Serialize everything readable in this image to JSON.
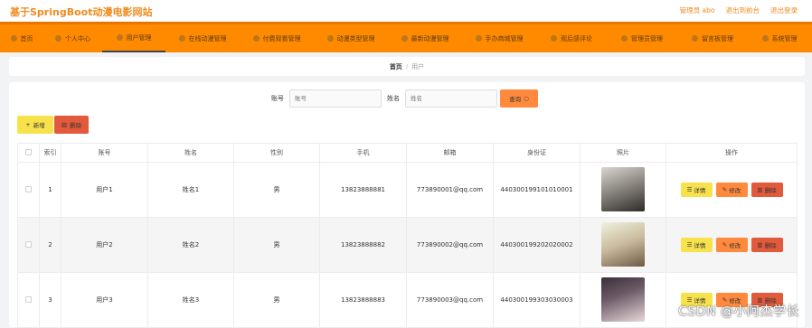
{
  "header": {
    "title": "基于SpringBoot动漫电影网站",
    "links": [
      "管理员 abo",
      "退出到前台",
      "退出登录"
    ]
  },
  "nav": {
    "items": [
      {
        "label": "首页",
        "icon": "home-icon"
      },
      {
        "label": "个人中心",
        "icon": "user-icon"
      },
      {
        "label": "用户管理",
        "icon": "users-icon",
        "active": true
      },
      {
        "label": "在线动漫管理",
        "icon": "film-icon"
      },
      {
        "label": "付费观看管理",
        "icon": "coin-icon"
      },
      {
        "label": "动漫类型管理",
        "icon": "tag-icon"
      },
      {
        "label": "最新动漫管理",
        "icon": "star-icon"
      },
      {
        "label": "手办商城管理",
        "icon": "shop-icon"
      },
      {
        "label": "观后感评论",
        "icon": "comment-icon"
      },
      {
        "label": "管理员管理",
        "icon": "admin-icon"
      },
      {
        "label": "留言板管理",
        "icon": "message-icon"
      },
      {
        "label": "系统管理",
        "icon": "gear-icon"
      }
    ]
  },
  "breadcrumb": {
    "home": "首页",
    "separator": "/",
    "current": "用户"
  },
  "search": {
    "account_label": "账号",
    "account_placeholder": "账号",
    "name_label": "姓名",
    "name_placeholder": "姓名",
    "query_label": "查询"
  },
  "actions": {
    "add_label": "新增",
    "delete_label": "删除"
  },
  "table": {
    "headers": [
      "索引",
      "账号",
      "姓名",
      "性别",
      "手机",
      "邮箱",
      "身份证",
      "照片",
      "操作"
    ],
    "rows": [
      {
        "index": "1",
        "account": "用户1",
        "name": "姓名1",
        "gender": "男",
        "phone": "13823888881",
        "email": "773890001@qq.com",
        "idcard": "440300199101010001",
        "photo_color": "#8f8a84"
      },
      {
        "index": "2",
        "account": "用户2",
        "name": "姓名2",
        "gender": "男",
        "phone": "13823888882",
        "email": "773890002@qq.com",
        "idcard": "440300199202020002",
        "photo_color": "#c9b99c"
      },
      {
        "index": "3",
        "account": "用户3",
        "name": "姓名3",
        "gender": "男",
        "phone": "13823888883",
        "email": "773890003@qq.com",
        "idcard": "440300199303030003",
        "photo_color": "#6b5a66"
      }
    ],
    "op_detail": "详情",
    "op_edit": "修改",
    "op_delete": "删除"
  },
  "watermark": "CSDN @小阿杰学长",
  "colors": {
    "accent": "#ff8a00",
    "brand_text": "#f08a1c",
    "query_button": "#ff8a3d",
    "add_button": "#f8e24c",
    "delete_button": "#e25a3b"
  }
}
